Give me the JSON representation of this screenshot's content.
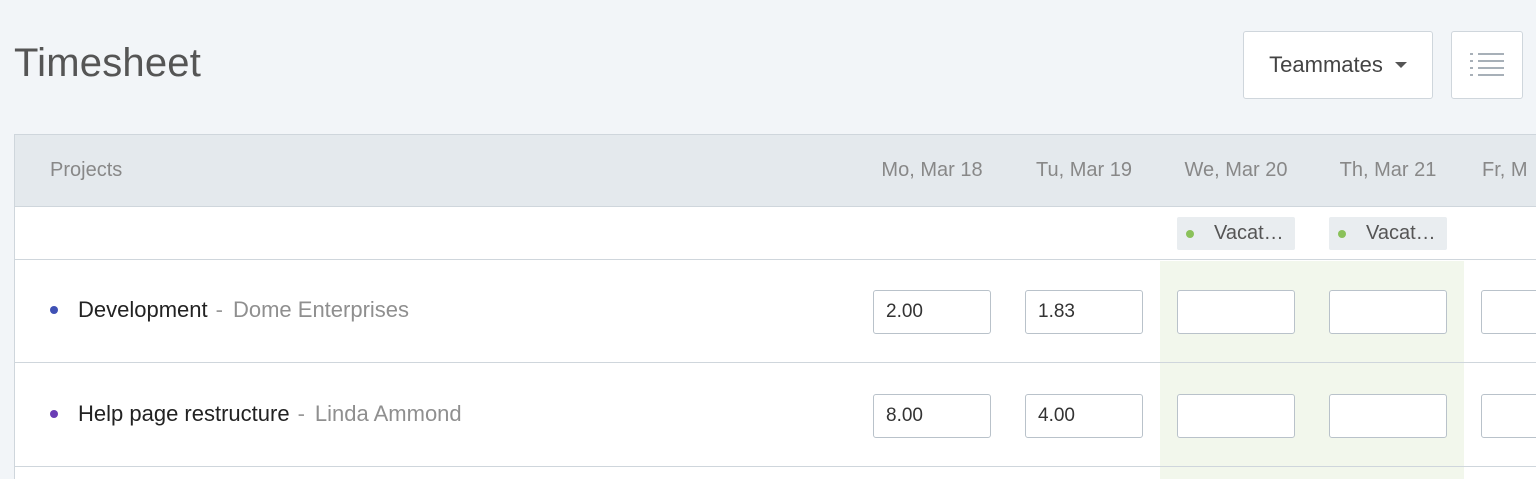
{
  "page": {
    "title": "Timesheet"
  },
  "toolbar": {
    "teammates_label": "Teammates",
    "teammates_icon": "chevron-down-icon",
    "view_toggle_icon": "list-icon"
  },
  "table": {
    "projects_header": "Projects",
    "days": [
      "Mo, Mar 18",
      "Tu, Mar 19",
      "We, Mar 20",
      "Th, Mar 21",
      "Fr, M"
    ],
    "time_off": [
      {
        "day": "We, Mar 20",
        "label": "Vacat…",
        "color": "#8ac15a"
      },
      {
        "day": "Th, Mar 21",
        "label": "Vacat…",
        "color": "#8ac15a"
      }
    ],
    "rows": [
      {
        "project": "Development",
        "separator": "-",
        "client": "Dome Enterprises",
        "dot_color": "#3f51b5",
        "hours": [
          "2.00",
          "1.83",
          "",
          "",
          ""
        ]
      },
      {
        "project": "Help page restructure",
        "separator": "-",
        "client": "Linda Ammond",
        "dot_color": "#6a3db5",
        "hours": [
          "8.00",
          "4.00",
          "",
          "",
          ""
        ]
      }
    ]
  }
}
